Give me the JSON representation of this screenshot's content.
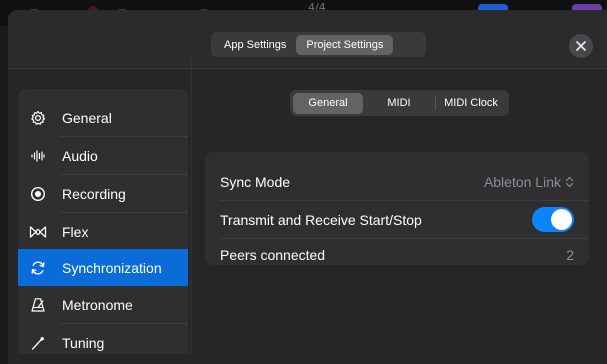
{
  "background_toolbar": {
    "time_signature": "4/4"
  },
  "header": {
    "tabs": [
      {
        "label": "App Settings",
        "active": false
      },
      {
        "label": "Project Settings",
        "active": true
      }
    ],
    "close_icon": "close-icon"
  },
  "sidebar": {
    "items": [
      {
        "label": "General",
        "icon": "gear-icon",
        "active": false
      },
      {
        "label": "Audio",
        "icon": "waveform-icon",
        "active": false
      },
      {
        "label": "Recording",
        "icon": "record-icon",
        "active": false
      },
      {
        "label": "Flex",
        "icon": "flex-icon",
        "active": false
      },
      {
        "label": "Synchronization",
        "icon": "sync-icon",
        "active": true
      },
      {
        "label": "Metronome",
        "icon": "metronome-icon",
        "active": false
      },
      {
        "label": "Tuning",
        "icon": "tuning-icon",
        "active": false
      }
    ]
  },
  "content": {
    "tabs": [
      {
        "label": "General",
        "active": true
      },
      {
        "label": "MIDI",
        "active": false
      },
      {
        "label": "MIDI Clock",
        "active": false
      }
    ],
    "settings": {
      "sync_mode": {
        "label": "Sync Mode",
        "value": "Ableton Link"
      },
      "transmit": {
        "label": "Transmit and Receive Start/Stop",
        "enabled": true
      },
      "peers": {
        "label": "Peers connected",
        "value": "2"
      }
    }
  },
  "colors": {
    "accent": "#0a84ff",
    "selection": "#0a6cd9",
    "background": "#262628"
  }
}
